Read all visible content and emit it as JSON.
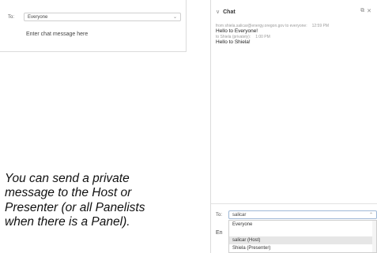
{
  "left_panel": {
    "to_label": "To:",
    "to_value": "Everyone",
    "input_placeholder": "Enter chat message here"
  },
  "caption": {
    "lines": [
      "You can send a private",
      "message to the Host or",
      "Presenter (or all Panelists",
      "when there is a Panel)."
    ]
  },
  "chat": {
    "title": "Chat",
    "messages": [
      {
        "meta": "from shiela.salicar@energy.oregon.gov to everyone:",
        "time": "12:59 PM",
        "text": "Hello to Everyone!"
      },
      {
        "meta": "to Shiela (privately):",
        "time": "1:00 PM",
        "text": "Hello to Shiela!"
      }
    ],
    "to_label": "To:",
    "to_value": "salicar",
    "input_stub": "En",
    "dropdown_options": [
      "Everyone",
      "salicar (Host)",
      "Shiela (Presenter)"
    ],
    "selected_option_index": 1
  },
  "icons": {
    "collapse": "chevron-down-icon",
    "popout": "popout-icon",
    "close": "close-icon"
  }
}
